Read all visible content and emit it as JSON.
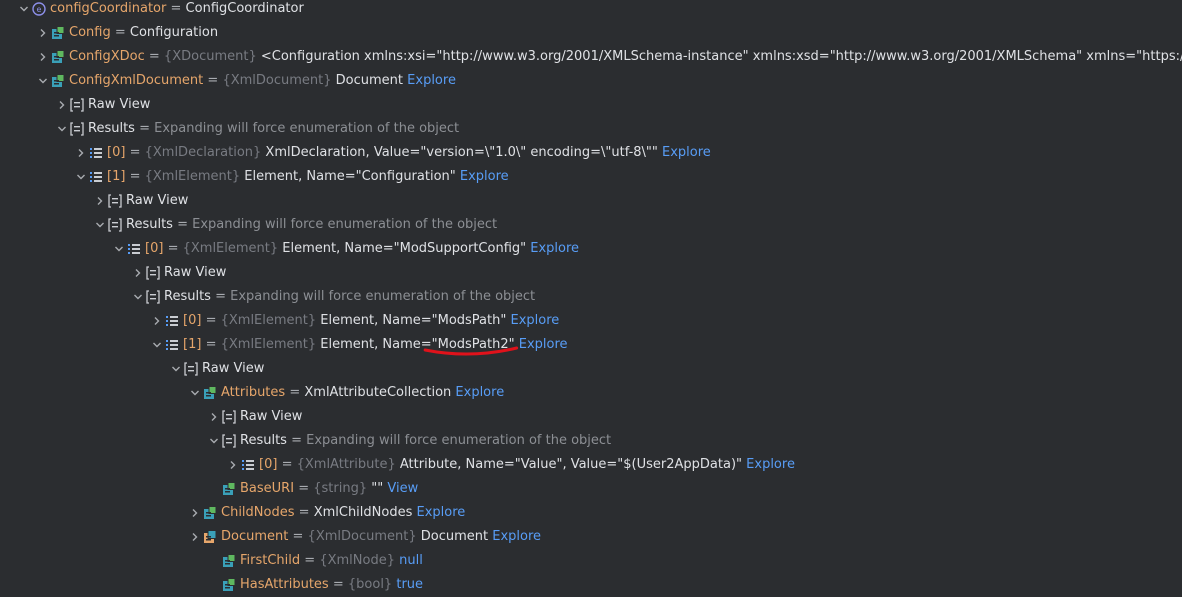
{
  "rows": [
    {
      "indent": 0,
      "expanded": true,
      "icon": "object-icon",
      "name": "configCoordinator",
      "nameStyle": "var",
      "eq": "=",
      "type": "",
      "value": "ConfigCoordinator",
      "link": ""
    },
    {
      "indent": 1,
      "expanded": false,
      "icon": "field-icon",
      "name": "Config",
      "nameStyle": "var",
      "eq": "=",
      "type": "",
      "value": "Configuration",
      "link": ""
    },
    {
      "indent": 1,
      "expanded": false,
      "icon": "field-icon",
      "name": "ConfigXDoc",
      "nameStyle": "var",
      "eq": "=",
      "type": "{XDocument}",
      "value": "<Configuration xmlns:xsi=\"http://www.w3.org/2001/XMLSchema-instance\" xmlns:xsd=\"http://www.w3.org/2001/XMLSchema\" xmlns=\"https://sc",
      "link": "View"
    },
    {
      "indent": 1,
      "expanded": true,
      "icon": "field-icon",
      "name": "ConfigXmlDocument",
      "nameStyle": "var",
      "eq": "=",
      "type": "{XmlDocument}",
      "value": "Document",
      "link": "Explore"
    },
    {
      "indent": 2,
      "expanded": false,
      "icon": "raw-view-icon",
      "name": "Raw View",
      "nameStyle": "plain",
      "eq": "",
      "type": "",
      "value": "",
      "link": ""
    },
    {
      "indent": 2,
      "expanded": true,
      "icon": "raw-view-icon",
      "name": "Results",
      "nameStyle": "plain",
      "eq": "=",
      "type": "",
      "value": "",
      "hint": "Expanding will force enumeration of the object",
      "link": ""
    },
    {
      "indent": 3,
      "expanded": false,
      "icon": "list-item-icon",
      "name": "[0]",
      "nameStyle": "var",
      "eq": "=",
      "type": "{XmlDeclaration}",
      "value": "XmlDeclaration, Value=\"version=\\\"1.0\\\" encoding=\\\"utf-8\\\"\"",
      "link": "Explore"
    },
    {
      "indent": 3,
      "expanded": true,
      "icon": "list-item-icon",
      "name": "[1]",
      "nameStyle": "var",
      "eq": "=",
      "type": "{XmlElement}",
      "value": "Element, Name=\"Configuration\"",
      "link": "Explore"
    },
    {
      "indent": 4,
      "expanded": false,
      "icon": "raw-view-icon",
      "name": "Raw View",
      "nameStyle": "plain",
      "eq": "",
      "type": "",
      "value": "",
      "link": ""
    },
    {
      "indent": 4,
      "expanded": true,
      "icon": "raw-view-icon",
      "name": "Results",
      "nameStyle": "plain",
      "eq": "=",
      "type": "",
      "value": "",
      "hint": "Expanding will force enumeration of the object",
      "link": ""
    },
    {
      "indent": 5,
      "expanded": true,
      "icon": "list-item-icon",
      "name": "[0]",
      "nameStyle": "var",
      "eq": "=",
      "type": "{XmlElement}",
      "value": "Element, Name=\"ModSupportConfig\"",
      "link": "Explore"
    },
    {
      "indent": 6,
      "expanded": false,
      "icon": "raw-view-icon",
      "name": "Raw View",
      "nameStyle": "plain",
      "eq": "",
      "type": "",
      "value": "",
      "link": ""
    },
    {
      "indent": 6,
      "expanded": true,
      "icon": "raw-view-icon",
      "name": "Results",
      "nameStyle": "plain",
      "eq": "=",
      "type": "",
      "value": "",
      "hint": "Expanding will force enumeration of the object",
      "link": ""
    },
    {
      "indent": 7,
      "expanded": false,
      "icon": "list-item-icon",
      "name": "[0]",
      "nameStyle": "var",
      "eq": "=",
      "type": "{XmlElement}",
      "value": "Element, Name=\"ModsPath\"",
      "link": "Explore"
    },
    {
      "indent": 7,
      "expanded": true,
      "icon": "list-item-icon",
      "name": "[1]",
      "nameStyle": "var",
      "eq": "=",
      "type": "{XmlElement}",
      "value": "Element, Name=\"ModsPath2\"",
      "link": "Explore",
      "underline": true
    },
    {
      "indent": 8,
      "expanded": true,
      "icon": "raw-view-icon",
      "name": "Raw View",
      "nameStyle": "plain",
      "eq": "",
      "type": "",
      "value": "",
      "link": ""
    },
    {
      "indent": 9,
      "expanded": true,
      "icon": "field-icon",
      "name": "Attributes",
      "nameStyle": "var",
      "eq": "=",
      "type": "",
      "value": "XmlAttributeCollection",
      "link": "Explore"
    },
    {
      "indent": 10,
      "expanded": false,
      "icon": "raw-view-icon",
      "name": "Raw View",
      "nameStyle": "plain",
      "eq": "",
      "type": "",
      "value": "",
      "link": ""
    },
    {
      "indent": 10,
      "expanded": true,
      "icon": "raw-view-icon",
      "name": "Results",
      "nameStyle": "plain",
      "eq": "=",
      "type": "",
      "value": "",
      "hint": "Expanding will force enumeration of the object",
      "link": ""
    },
    {
      "indent": 11,
      "expanded": false,
      "icon": "list-item-icon",
      "name": "[0]",
      "nameStyle": "var",
      "eq": "=",
      "type": "{XmlAttribute}",
      "value": "Attribute, Name=\"Value\", Value=\"$(User2AppData)\"",
      "link": "Explore"
    },
    {
      "indent": 10,
      "leaf": true,
      "icon": "field-icon",
      "name": "BaseURI",
      "nameStyle": "var",
      "eq": "=",
      "type": "{string}",
      "value": "\"\"",
      "link": "View"
    },
    {
      "indent": 9,
      "expanded": false,
      "icon": "field-icon",
      "name": "ChildNodes",
      "nameStyle": "var",
      "eq": "=",
      "type": "",
      "value": "XmlChildNodes",
      "link": "Explore"
    },
    {
      "indent": 9,
      "expanded": false,
      "icon": "object-field-icon",
      "name": "Document",
      "nameStyle": "var",
      "eq": "=",
      "type": "{XmlDocument}",
      "value": "Document",
      "link": "Explore"
    },
    {
      "indent": 10,
      "leaf": true,
      "icon": "field-icon",
      "name": "FirstChild",
      "nameStyle": "var",
      "eq": "=",
      "type": "{XmlNode}",
      "value": "null",
      "valueStyle": "link",
      "link": ""
    },
    {
      "indent": 10,
      "leaf": true,
      "icon": "field-icon",
      "name": "HasAttributes",
      "nameStyle": "var",
      "eq": "=",
      "type": "{bool}",
      "value": "true",
      "valueStyle": "link",
      "link": ""
    }
  ]
}
